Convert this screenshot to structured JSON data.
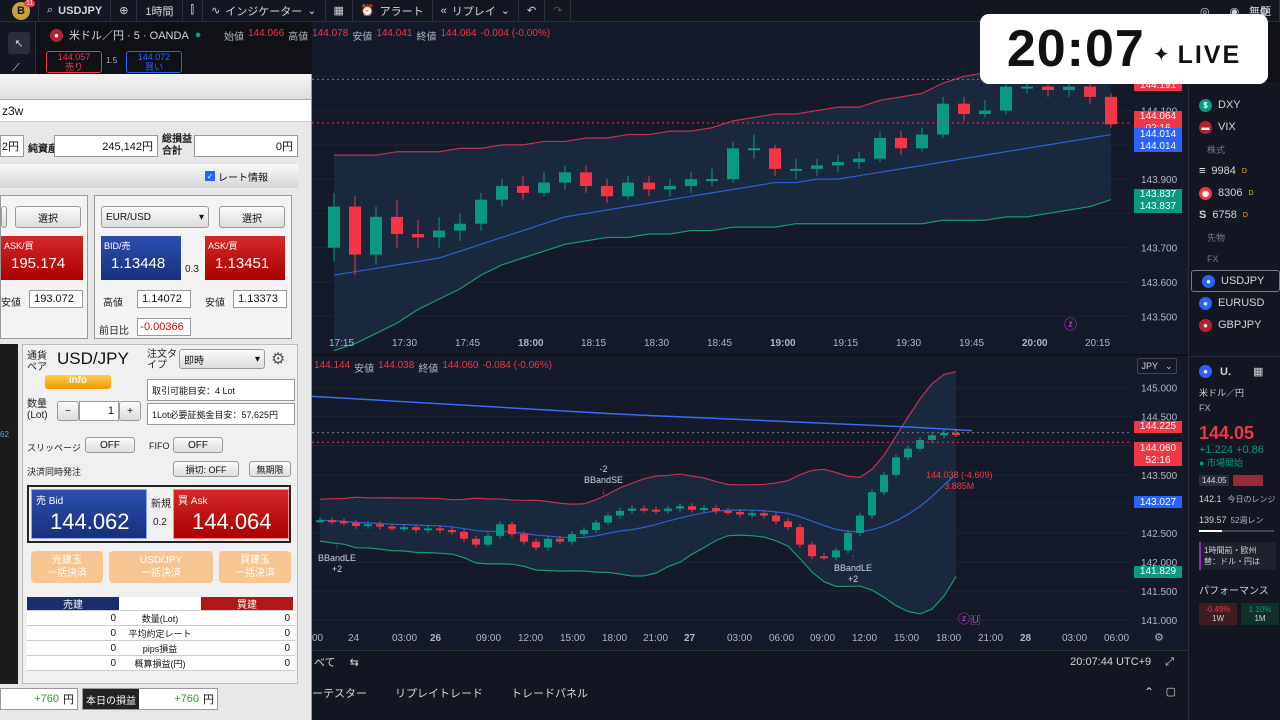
{
  "topbar": {
    "symbol": "USDJPY",
    "badge": "11",
    "interval": "1時間",
    "indicators": "インジケーター",
    "alert": "アラート",
    "replay": "リプレイ",
    "right_label": "無題"
  },
  "chart1": {
    "title": "米ドル／円 · 5 · OANDA",
    "ohlc": {
      "o_label": "始値",
      "o": "144.066",
      "h_label": "高値",
      "h": "144.078",
      "l_label": "安値",
      "l": "144.041",
      "c_label": "終値",
      "c": "144.064",
      "chg": "-0.004 (-0.00%)"
    },
    "sell_price": "144.057",
    "sell_label": "売り",
    "spread": "1.5",
    "buy_price": "144.072",
    "buy_label": "買い",
    "yticks": [
      "143.500",
      "143.600",
      "143.700",
      "143.900",
      "144.100"
    ],
    "xticks": [
      "17:15",
      "17:30",
      "17:45",
      "18:00",
      "18:15",
      "18:30",
      "18:45",
      "19:00",
      "19:15",
      "19:30",
      "19:45",
      "20:00",
      "20:15"
    ],
    "price_labels": [
      {
        "text": "144.191",
        "color": "#f23645"
      },
      {
        "text": "144.191",
        "color": "#f23645"
      },
      {
        "text": "144.064",
        "color": "#f23645"
      },
      {
        "text": "02:16",
        "color": "#f23645"
      },
      {
        "text": "144.014",
        "color": "#2962ff"
      },
      {
        "text": "144.014",
        "color": "#2962ff"
      },
      {
        "text": "143.837",
        "color": "#089981"
      },
      {
        "text": "143.837",
        "color": "#089981"
      }
    ],
    "candles": [
      [
        143.7,
        143.82,
        143.86,
        143.66
      ],
      [
        143.82,
        143.68,
        143.85,
        143.62
      ],
      [
        143.68,
        143.79,
        143.82,
        143.65
      ],
      [
        143.79,
        143.74,
        143.84,
        143.7
      ],
      [
        143.74,
        143.73,
        143.78,
        143.7
      ],
      [
        143.73,
        143.75,
        143.79,
        143.7
      ],
      [
        143.75,
        143.77,
        143.8,
        143.72
      ],
      [
        143.77,
        143.84,
        143.86,
        143.75
      ],
      [
        143.84,
        143.88,
        143.9,
        143.82
      ],
      [
        143.88,
        143.86,
        143.91,
        143.84
      ],
      [
        143.86,
        143.89,
        143.92,
        143.85
      ],
      [
        143.89,
        143.92,
        143.94,
        143.87
      ],
      [
        143.92,
        143.88,
        143.94,
        143.86
      ],
      [
        143.88,
        143.85,
        143.9,
        143.83
      ],
      [
        143.85,
        143.89,
        143.91,
        143.84
      ],
      [
        143.89,
        143.87,
        143.91,
        143.85
      ],
      [
        143.87,
        143.88,
        143.9,
        143.85
      ],
      [
        143.88,
        143.9,
        143.92,
        143.86
      ],
      [
        143.9,
        143.9,
        143.93,
        143.88
      ],
      [
        143.9,
        143.99,
        144.01,
        143.89
      ],
      [
        143.99,
        143.99,
        144.03,
        143.96
      ],
      [
        143.99,
        143.93,
        144.0,
        143.91
      ],
      [
        143.93,
        143.93,
        143.96,
        143.9
      ],
      [
        143.93,
        143.94,
        143.96,
        143.91
      ],
      [
        143.94,
        143.95,
        143.97,
        143.92
      ],
      [
        143.95,
        143.96,
        143.98,
        143.93
      ],
      [
        143.96,
        144.02,
        144.04,
        143.95
      ],
      [
        144.02,
        143.99,
        144.04,
        143.97
      ],
      [
        143.99,
        144.03,
        144.05,
        143.98
      ],
      [
        144.03,
        144.12,
        144.14,
        144.02
      ],
      [
        144.12,
        144.09,
        144.14,
        144.07
      ],
      [
        144.09,
        144.1,
        144.13,
        144.08
      ],
      [
        144.1,
        144.17,
        144.19,
        144.09
      ],
      [
        144.17,
        144.17,
        144.2,
        144.15
      ],
      [
        144.17,
        144.16,
        144.21,
        144.14
      ],
      [
        144.16,
        144.17,
        144.19,
        144.14
      ],
      [
        144.17,
        144.14,
        144.18,
        144.12
      ],
      [
        144.14,
        144.06,
        144.15,
        144.05
      ]
    ],
    "bb_upper": [
      143.97,
      143.97,
      143.97,
      143.98,
      143.98,
      143.98,
      143.99,
      143.99,
      144.0,
      144.0,
      144.01,
      144.01,
      144.02,
      144.02,
      144.03,
      144.03,
      144.04,
      144.04,
      144.05,
      144.07,
      144.08,
      144.09,
      144.09,
      144.1,
      144.11,
      144.11,
      144.13,
      144.14,
      144.15,
      144.18,
      144.2,
      144.21,
      144.24,
      144.25,
      144.26,
      144.27,
      144.27,
      144.26
    ],
    "bb_mid": [
      143.62,
      143.63,
      143.64,
      143.65,
      143.66,
      143.67,
      143.69,
      143.71,
      143.73,
      143.75,
      143.77,
      143.79,
      143.8,
      143.81,
      143.82,
      143.83,
      143.84,
      143.85,
      143.86,
      143.87,
      143.88,
      143.89,
      143.89,
      143.9,
      143.9,
      143.91,
      143.92,
      143.93,
      143.94,
      143.95,
      143.96,
      143.97,
      143.98,
      143.99,
      144.0,
      144.01,
      144.02,
      144.03
    ],
    "bb_lower": [
      143.4,
      143.42,
      143.45,
      143.48,
      143.52,
      143.55,
      143.58,
      143.62,
      143.65,
      143.67,
      143.69,
      143.71,
      143.72,
      143.73,
      143.73,
      143.74,
      143.74,
      143.75,
      143.75,
      143.76,
      143.76,
      143.76,
      143.77,
      143.77,
      143.77,
      143.77,
      143.77,
      143.77,
      143.77,
      143.78,
      143.78,
      143.78,
      143.79,
      143.79,
      143.8,
      143.81,
      143.82,
      143.84
    ]
  },
  "chart2": {
    "ohlc": {
      "h": "144.144",
      "l_label": "安値",
      "l": "144.038",
      "c_label": "終値",
      "c": "144.060",
      "chg": "-0.084 (-0.06%)"
    },
    "currency": "JPY",
    "yticks": [
      "141.000",
      "141.500",
      "142.000",
      "142.500",
      "143.500",
      "144.000",
      "144.500",
      "145.000"
    ],
    "xticks": [
      "00",
      "24",
      "03:00",
      "26",
      "09:00",
      "12:00",
      "15:00",
      "18:00",
      "21:00",
      "27",
      "03:00",
      "06:00",
      "09:00",
      "12:00",
      "15:00",
      "18:00",
      "21:00",
      "28",
      "03:00",
      "06:00"
    ],
    "price_labels": [
      {
        "text": "144.225",
        "color": "#f23645"
      },
      {
        "text": "144.060",
        "color": "#f23645"
      },
      {
        "text": "52:16",
        "color": "#f23645"
      },
      {
        "text": "143.027",
        "color": "#2962ff"
      },
      {
        "text": "141.829",
        "color": "#089981"
      }
    ],
    "annotations": {
      "bbandse_n": "-2",
      "bbandse": "BBandSE",
      "bbandle1": "BBandLE",
      "bbandle1_n": "+2",
      "bbandle2": "BBandLE",
      "bbandle2_n": "+2",
      "measure": "144.038 (-4.609)",
      "measure_vol": "3.885M"
    },
    "closes": [
      142.72,
      142.7,
      142.68,
      142.62,
      142.65,
      142.61,
      142.58,
      142.6,
      142.55,
      142.58,
      142.55,
      142.52,
      142.4,
      142.3,
      142.45,
      142.65,
      142.48,
      142.35,
      142.25,
      142.4,
      142.35,
      142.48,
      142.55,
      142.68,
      142.8,
      142.88,
      142.92,
      142.9,
      142.88,
      142.92,
      142.96,
      142.9,
      142.93,
      142.88,
      142.86,
      142.82,
      142.84,
      142.8,
      142.7,
      142.6,
      142.3,
      142.1,
      142.08,
      142.2,
      142.5,
      142.8,
      143.2,
      143.5,
      143.8,
      143.95,
      144.1,
      144.18,
      144.22,
      144.2
    ]
  },
  "bottombar": {
    "left": "べて",
    "time": "20:07:44 UTC+9",
    "tabs": [
      "ーテスター",
      "リプレイトレード",
      "トレードパネル"
    ]
  },
  "live": {
    "time": "20:07",
    "label": "LIVE"
  },
  "rightpanel": {
    "items1": [
      "DXY",
      "VIX"
    ],
    "sec_stock": "株式",
    "stocks": [
      {
        "code": "9984",
        "tag": "D"
      },
      {
        "code": "8306",
        "tag": "D"
      },
      {
        "code": "6758",
        "tag": "D"
      }
    ],
    "sec_fut": "先物",
    "sec_fx": "FX",
    "fx": [
      "USDJPY",
      "EURUSD",
      "GBPJPY"
    ],
    "detail": {
      "head": "U.",
      "name": "米ドル／円",
      "type": "FX",
      "price": "144.05",
      "chg": "+1.224",
      "chg_pct": "+0.86",
      "status": "市場開始",
      "chip1": "144.05",
      "low": "142.1",
      "range_label": "今日のレンジ",
      "w52": "139.57",
      "w52_label": "52週レン",
      "notice": "1時間前・欧州",
      "notice2": "替：ドル・円は",
      "perf": "パフォーマンス",
      "p1": "-0.49%",
      "p1l": "1W",
      "p2": "1.10%",
      "p2l": "1M"
    }
  },
  "trade": {
    "title": "z3w",
    "net_asset_label": "純資産",
    "net_asset": "245,142円",
    "left_val": "2円",
    "total_pl_label": "総損益合計",
    "total_pl": "0円",
    "rate_info": "レート情報",
    "pair2": "EUR/USD",
    "select": "選択",
    "ask_label": "ASK/買",
    "bid_label": "BID/売",
    "p1_ask": "195.174",
    "p1_low_label": "安値",
    "p1_low": "193.072",
    "p2_bid": "1.13448",
    "p2_spread": "0.3",
    "p2_ask": "1.13451",
    "p2_high_label": "高値",
    "p2_high": "1.14072",
    "p2_low_label": "安値",
    "p2_low": "1.13373",
    "p2_prev_label": "前日比",
    "p2_prev": "-0.00366",
    "pair_label": "通貨ペア",
    "pair": "USD/JPY",
    "info": "info",
    "order_type_label": "注文タイプ",
    "order_type": "即時",
    "avail": "取引可能目安：4 Lot",
    "qty_label": "数量(Lot)",
    "qty": "1",
    "minus": "−",
    "plus": "+",
    "margin": "1Lot必要証拠金目安：57,625円",
    "slip_label": "スリッページ",
    "slip": "OFF",
    "fifo_label": "FIFO",
    "fifo": "OFF",
    "settle_label": "決済同時発注",
    "stop": "損切: OFF",
    "unlimited": "無期限",
    "sell_bid_label": "売 Bid",
    "sell_bid": "144.062",
    "new_label": "新規",
    "spread": "0.2",
    "buy_ask_label": "買 Ask",
    "buy_ask": "144.064",
    "close_sell": "売建玉",
    "close_all_sell": "一括決済",
    "close_pair": "USD/JPY",
    "close_all_pair": "一括決済",
    "close_buy": "買建玉",
    "close_all_buy": "一括決済",
    "sell_head": "売建",
    "buy_head": "買建",
    "rows": [
      {
        "label": "数量(Lot)",
        "sell": "0",
        "buy": "0"
      },
      {
        "label": "平均約定レート",
        "sell": "0",
        "buy": "0"
      },
      {
        "label": "pips損益",
        "sell": "0",
        "buy": "0"
      },
      {
        "label": "概算損益(円)",
        "sell": "0",
        "buy": "0"
      }
    ],
    "pl_left": "+760",
    "yen": "円",
    "today_label": "本日の損益",
    "today": "+760",
    "left_edge": "62"
  }
}
